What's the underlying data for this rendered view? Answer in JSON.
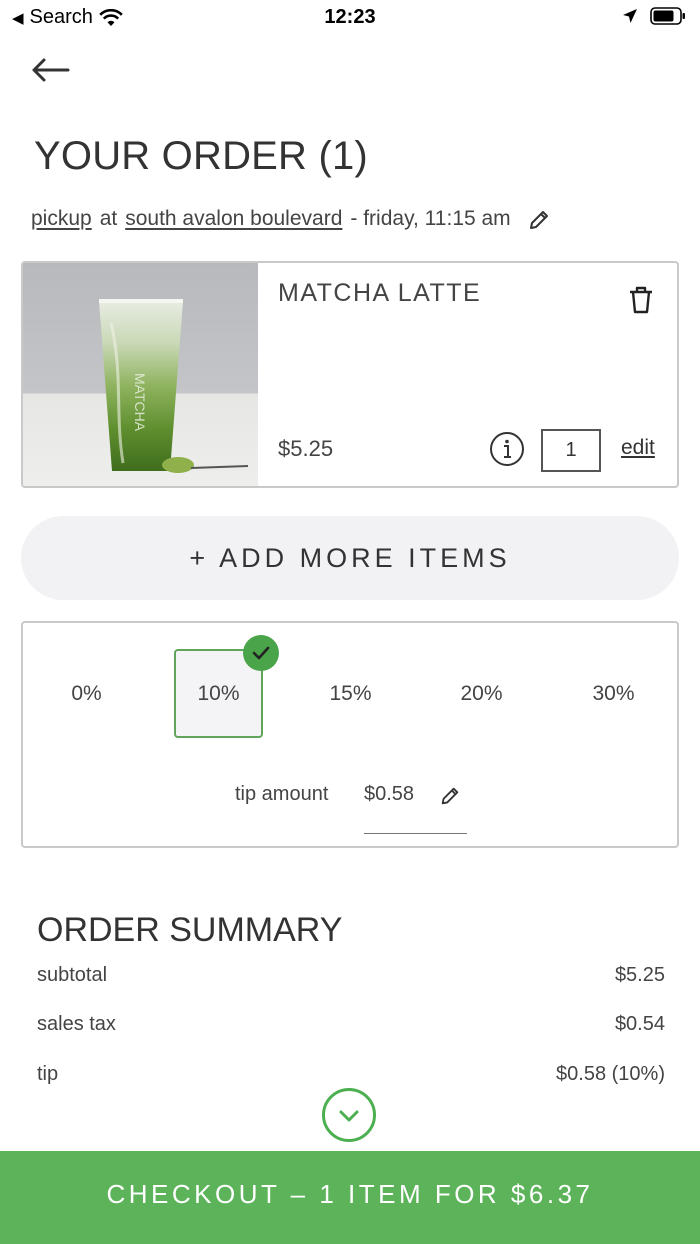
{
  "status_bar": {
    "back_app": "Search",
    "time": "12:23"
  },
  "title": "YOUR ORDER (1)",
  "pickup": {
    "mode": "pickup",
    "at": "at",
    "location": "south avalon boulevard",
    "time": "- friday, 11:15 am"
  },
  "item": {
    "name": "MATCHA LATTE",
    "price": "$5.25",
    "quantity": "1",
    "edit": "edit"
  },
  "add_more": "+ ADD MORE ITEMS",
  "tip": {
    "options": [
      "0%",
      "10%",
      "15%",
      "20%",
      "30%"
    ],
    "selected": "10%",
    "label": "tip amount",
    "amount": "$0.58"
  },
  "summary": {
    "title": "ORDER SUMMARY",
    "rows": [
      {
        "label": "subtotal",
        "value": "$5.25"
      },
      {
        "label": "sales tax",
        "value": "$0.54"
      },
      {
        "label": "tip",
        "value": "$0.58 (10%)"
      }
    ]
  },
  "checkout": "CHECKOUT – 1 ITEM FOR $6.37",
  "colors": {
    "accent_green": "#5cb35a",
    "check_green": "#4aa44a",
    "pill_bg": "#f2f2f5"
  }
}
